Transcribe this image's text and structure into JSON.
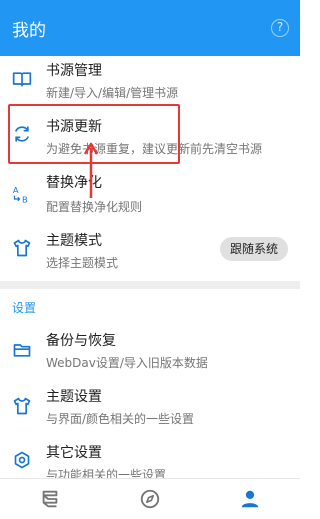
{
  "appbar": {
    "title": "我的",
    "help_icon_glyph": "?"
  },
  "list_top": [
    {
      "title": "书源管理",
      "subtitle": "新建/导入/编辑/管理书源",
      "icon": "book-icon"
    },
    {
      "title": "书源更新",
      "subtitle": "为避免书源重复，建议更新前先清空书源",
      "icon": "refresh-icon"
    },
    {
      "title": "替换净化",
      "subtitle": "配置替换净化规则",
      "icon": "replace-icon"
    },
    {
      "title": "主题模式",
      "subtitle": "选择主题模式",
      "icon": "shirt-icon",
      "chip": "跟随系统"
    }
  ],
  "settings_section": {
    "title": "设置",
    "items": [
      {
        "title": "备份与恢复",
        "subtitle": "WebDav设置/导入旧版本数据",
        "icon": "folder-icon"
      },
      {
        "title": "主题设置",
        "subtitle": "与界面/颜色相关的一些设置",
        "icon": "shirt-icon"
      },
      {
        "title": "其它设置",
        "subtitle": "与功能相关的一些设置",
        "icon": "gear-icon"
      }
    ]
  },
  "bottom_nav": [
    {
      "name": "bookshelf",
      "icon": "bookshelf-icon",
      "active": false
    },
    {
      "name": "explore",
      "icon": "compass-icon",
      "active": false
    },
    {
      "name": "my",
      "icon": "person-icon",
      "active": true
    }
  ],
  "colors": {
    "primary": "#2196f3",
    "icon_blue": "#1976d2",
    "highlight_red": "#e53935",
    "nav_inactive": "#757575"
  }
}
